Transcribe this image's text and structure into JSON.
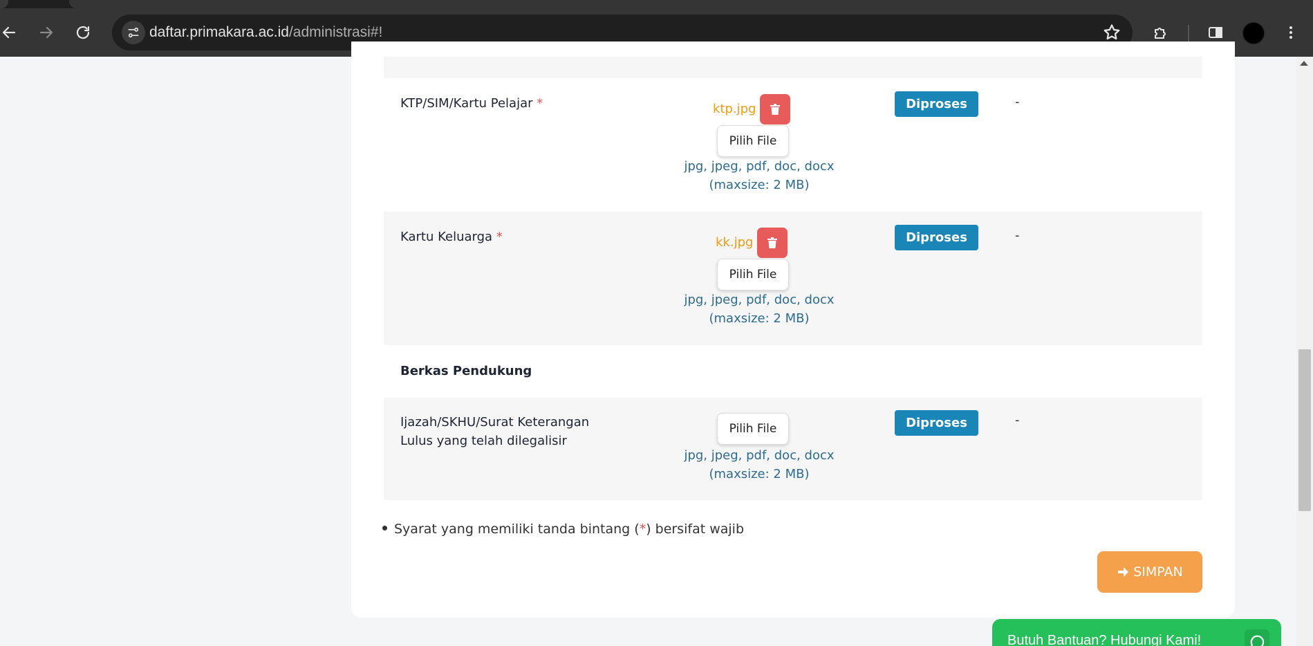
{
  "browser": {
    "url_domain": "daftar.primakara.ac.id",
    "url_path": "/administrasi#!",
    "icons": [
      "back-icon",
      "forward-icon",
      "reload-icon",
      "site-settings-icon",
      "star-icon",
      "extensions-icon",
      "sidebar-icon",
      "profile-avatar",
      "menu-icon"
    ]
  },
  "documents": [
    {
      "label": "KTP/SIM/Kartu Pelajar",
      "required_mark": "*",
      "file_name": "ktp.jpg",
      "pick_label": "Pilih File",
      "hint_line1": "jpg, jpeg, pdf, doc, docx",
      "hint_line2": "(maxsize: 2 MB)",
      "status": "Diproses",
      "note": "-"
    },
    {
      "label": "Kartu Keluarga",
      "required_mark": "*",
      "file_name": "kk.jpg",
      "pick_label": "Pilih File",
      "hint_line1": "jpg, jpeg, pdf, doc, docx",
      "hint_line2": "(maxsize: 2 MB)",
      "status": "Diproses",
      "note": "-"
    }
  ],
  "supporting": {
    "title": "Berkas Pendukung",
    "items": [
      {
        "label_line1": "Ijazah/SKHU/Surat Keterangan",
        "label_line2": "Lulus yang telah dilegalisir",
        "pick_label": "Pilih File",
        "hint_line1": "jpg, jpeg, pdf, doc, docx",
        "hint_line2": "(maxsize: 2 MB)",
        "status": "Diproses",
        "note": "-"
      }
    ]
  },
  "footnote": {
    "before": "Syarat yang memiliki tanda bintang (",
    "star": "*",
    "after": ") bersifat wajib"
  },
  "save_label": "SIMPAN",
  "help_widget": {
    "text": "Butuh Bantuan? Hubungi Kami!"
  },
  "colors": {
    "status_badge": "#1a86b8",
    "delete": "#e85b5b",
    "file_name": "#f39c12",
    "save": "#f5a04a",
    "whatsapp": "#25c05a"
  }
}
